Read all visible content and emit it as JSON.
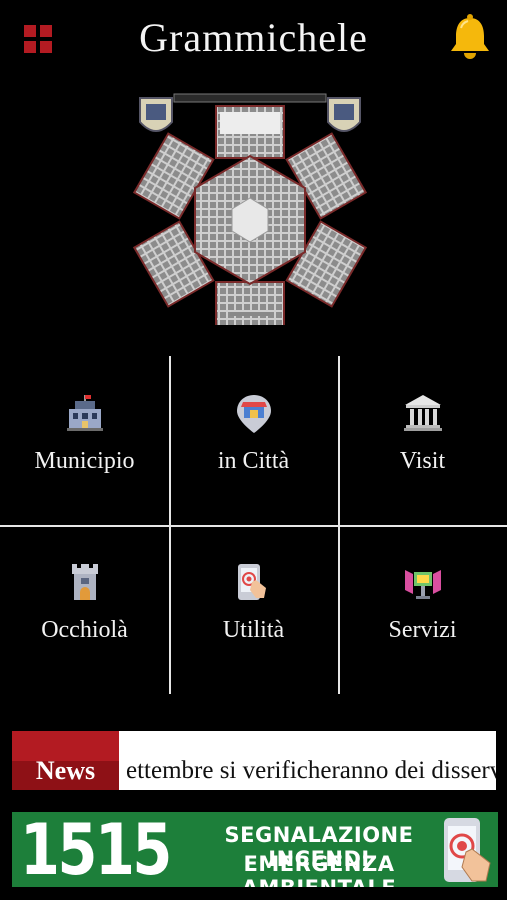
{
  "header": {
    "title": "Grammichele",
    "menu_icon": "grid-menu-icon",
    "bell_icon": "bell-icon"
  },
  "hero": {
    "image": "grammichele-hexagonal-town-map"
  },
  "grid": [
    {
      "label": "Municipio",
      "icon": "town-hall-icon"
    },
    {
      "label": "in Città",
      "icon": "shop-pin-icon"
    },
    {
      "label": "Visit",
      "icon": "museum-icon"
    },
    {
      "label": "Occhiolà",
      "icon": "tower-icon"
    },
    {
      "label": "Utilità",
      "icon": "phone-tap-icon"
    },
    {
      "label": "Servizi",
      "icon": "services-icon"
    }
  ],
  "news": {
    "label": "News",
    "ticker": "ettembre si verificheranno dei disservizi"
  },
  "banner": {
    "number": "1515",
    "line1": "SEGNALAZIONE INCENDI",
    "line2": "EMERGENZA AMBIENTALE",
    "icon": "phone-tap-icon"
  },
  "colors": {
    "background": "#000000",
    "accent_red": "#b31b22",
    "bell_yellow": "#f5b80c",
    "banner_green": "#1d7f3a",
    "grid_lines": "#e6e6e6"
  }
}
